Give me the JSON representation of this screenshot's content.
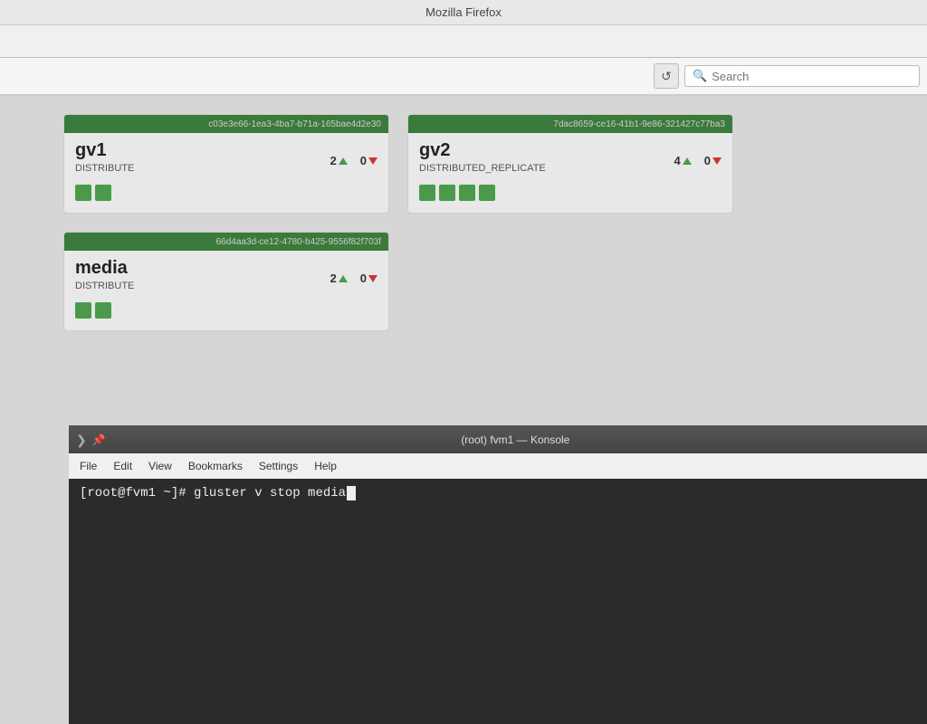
{
  "titlebar": {
    "label": "Mozilla Firefox"
  },
  "navbar": {
    "refresh_title": "Refresh",
    "search_placeholder": "Search"
  },
  "volumes": [
    {
      "id": "c03e3e66-1ea3-4ba7-b71a-165bae4d2e30",
      "name": "gv1",
      "type": "DISTRIBUTE",
      "up": 2,
      "down": 0,
      "bricks": 2
    },
    {
      "id": "7dac8659-ce16-41b1-9e86-321427c77ba3",
      "name": "gv2",
      "type": "DISTRIBUTED_REPLICATE",
      "up": 4,
      "down": 0,
      "bricks": 4
    },
    {
      "id": "66d4aa3d-ce12-4780-b425-9556f82f703f",
      "name": "media",
      "type": "DISTRIBUTE",
      "up": 2,
      "down": 0,
      "bricks": 2
    }
  ],
  "konsole": {
    "title": "(root) fvm1 — Konsole",
    "menu": {
      "file": "File",
      "edit": "Edit",
      "view": "View",
      "bookmarks": "Bookmarks",
      "settings": "Settings",
      "help": "Help"
    },
    "terminal_text": "[root@fvm1 ~]# gluster v stop media "
  }
}
